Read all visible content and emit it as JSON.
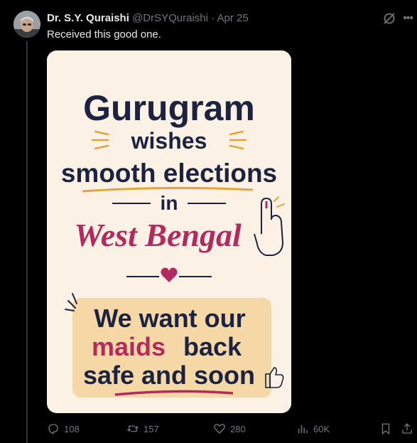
{
  "tweet": {
    "author_name": "Dr. S.Y. Quraishi",
    "handle": "@DrSYQuraishi",
    "separator": "·",
    "date": "Apr 25",
    "text": "Received this good one."
  },
  "image_text": {
    "line1": "Gurugram",
    "line2": "wishes",
    "line3": "smooth elections",
    "line4": "in",
    "line5": "West Bengal",
    "box_line1": "We want our",
    "box_line2_highlight": "maids",
    "box_line2_rest": "back",
    "box_line3": "safe and soon"
  },
  "actions": {
    "replies": "108",
    "reposts": "157",
    "likes": "280",
    "views": "60K"
  },
  "icons": [
    "grok-icon",
    "more-icon",
    "reply-icon",
    "repost-icon",
    "like-icon",
    "views-icon",
    "bookmark-icon",
    "share-icon"
  ],
  "colors": {
    "background": "#000000",
    "text_primary": "#e7e9ea",
    "text_secondary": "#71767b",
    "poster_navy": "#1b2340",
    "poster_magenta": "#b32a5e",
    "poster_gold": "#e0a63a"
  }
}
